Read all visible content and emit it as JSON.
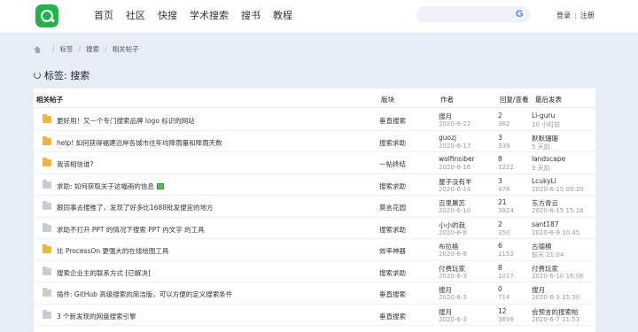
{
  "header": {
    "nav": [
      "首页",
      "社区",
      "快搜",
      "学术搜索",
      "搜书",
      "教程"
    ],
    "search_placeholder": "",
    "google_icon": "google-icon",
    "login": "登录",
    "register": "注册"
  },
  "breadcrumb": {
    "home_icon": "home-icon",
    "items": [
      "标签",
      "搜索",
      "相关帖子"
    ]
  },
  "page_title": "标签: 搜索",
  "table": {
    "headers": {
      "topic": "相关帖子",
      "forum": "版块",
      "author": "作者",
      "stats": "回复/查看",
      "last": "最后发表"
    },
    "rows": [
      {
        "title": "更好用！又一个专门搜索品牌 logo 标识的网站",
        "forum": "垂直搜索",
        "author": "搜月",
        "date": "2020-6-22",
        "replies": "2",
        "views": "362",
        "last_user": "Li-guru",
        "last_time": "10 小时前",
        "folder": "new",
        "img": false
      },
      {
        "title": "help! 如何获得福建沿岸各城市往年均降雨量和降雨天数",
        "forum": "搜索求助",
        "author": "guozj",
        "date": "2020-6-17",
        "replies": "3",
        "views": "339",
        "last_user": "默默珊珊",
        "last_time": "5 天前",
        "folder": "new",
        "img": false
      },
      {
        "title": "我该相信谁?",
        "forum": "一帖终结",
        "author": "wolfinsiber",
        "date": "2020-6-16",
        "replies": "8",
        "views": "1222",
        "last_user": "landscape",
        "last_time": "3 天前",
        "folder": "new",
        "img": false
      },
      {
        "title": "求助: 如何获取关于这幅画的信息",
        "forum": "搜索求助",
        "author": "屋子没有羊",
        "date": "2020-6-14",
        "replies": "3",
        "views": "478",
        "last_user": "LcukyLi",
        "last_time": "2020-6-15 09:20",
        "folder": "old",
        "img": true
      },
      {
        "title": "跟同事去搜推了，发现了好多比1688批发便宜的地方",
        "forum": "莫言花园",
        "author": "百里屠苏",
        "date": "2020-6-10",
        "replies": "21",
        "views": "3824",
        "last_user": "东方青云",
        "last_time": "2020-6-15 15:16",
        "folder": "old",
        "img": false
      },
      {
        "title": "求助不打开 PPT 的情况下搜索 PPT 内文字 的工具",
        "forum": "搜索求助",
        "author": "小小的我",
        "date": "2020-6-8",
        "replies": "2",
        "views": "350",
        "last_user": "sant187",
        "last_time": "2020-6-9 10:45",
        "folder": "old",
        "img": false
      },
      {
        "title": "比 ProcessOn 更强大的在线绘图工具",
        "forum": "效率神器",
        "author": "布拉格",
        "date": "2020-6-8",
        "replies": "6",
        "views": "1153",
        "last_user": "古德模",
        "last_time": "前天 21:04",
        "folder": "new",
        "img": false
      },
      {
        "title": "搜索企业主的联系方式 [已解决]",
        "forum": "搜索求助",
        "author": "付费玩家",
        "date": "2020-6-3",
        "replies": "8",
        "views": "1017",
        "last_user": "付费玩家",
        "last_time": "2020-6-10 16:08",
        "folder": "old",
        "img": false
      },
      {
        "title": "插件: GitHub 高级搜索的简洁版，可以方便的定义搜索条件",
        "forum": "垂直搜索",
        "author": "搜月",
        "date": "2020-6-3",
        "replies": "0",
        "views": "714",
        "last_user": "搜月",
        "last_time": "2020-6-3 15:30",
        "folder": "old",
        "img": false
      },
      {
        "title": "3 个新发现的网盘搜索引擎",
        "forum": "垂直搜索",
        "author": "搜月",
        "date": "2020-6-3",
        "replies": "12",
        "views": "3699",
        "last_user": "会预言的搜索帕",
        "last_time": "2020-6-7 11:53",
        "folder": "old",
        "img": false
      }
    ]
  },
  "colors": {
    "brand_green": "#21b24a",
    "folder_new": "#f0b53f",
    "folder_old": "#c8ccd2",
    "background": "#e8edf5"
  }
}
